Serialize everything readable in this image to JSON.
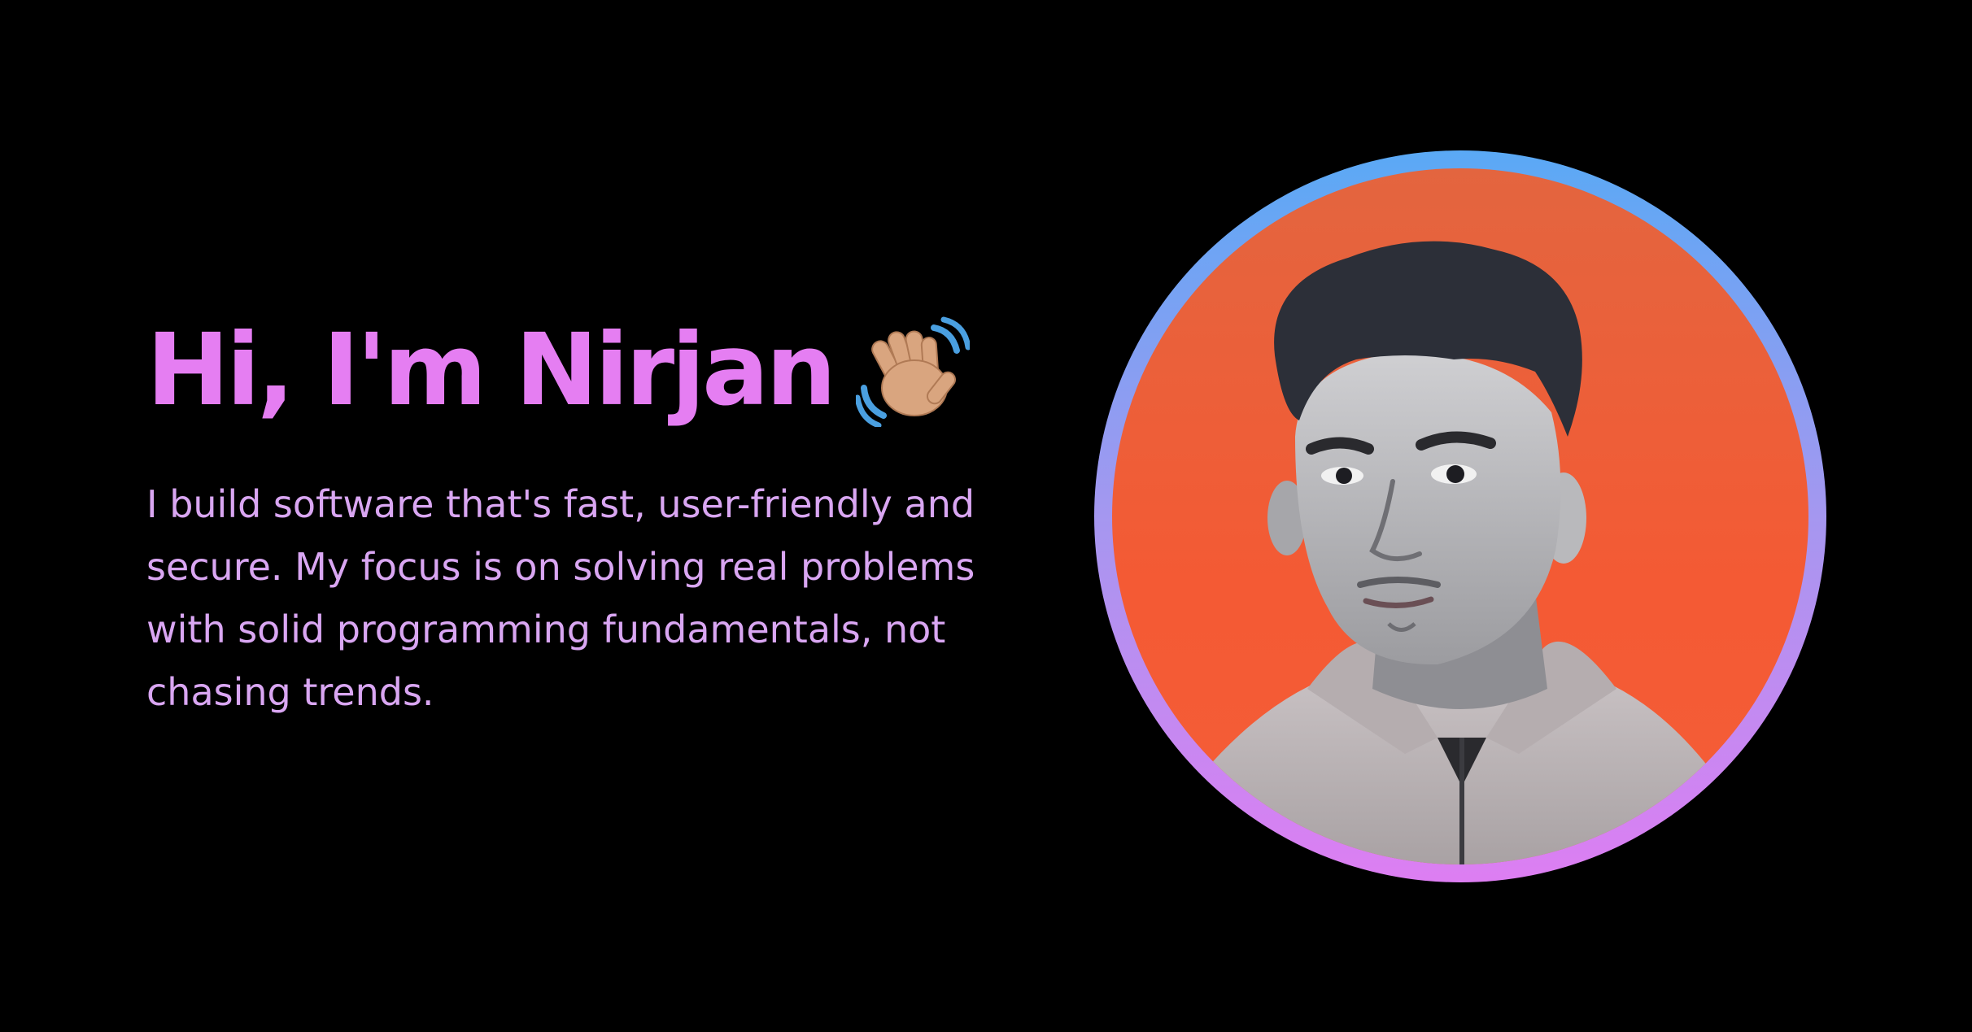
{
  "hero": {
    "greeting": "Hi, I'm Nirjan",
    "wave_icon": "waving-hand-icon",
    "bio_lines": [
      "I build software that's fast, user-friendly and",
      "secure. My focus is on solving real problems",
      "with solid programming fundamentals, not",
      "chasing trends."
    ]
  },
  "portrait": {
    "ring_colors": [
      "#5aa9f5",
      "#a597f0",
      "#dd7ef2"
    ],
    "background_color": "#f45a34"
  },
  "colors": {
    "page_background": "#000000",
    "greeting": "#e57ef2",
    "bio_text": "#d9a6f2"
  }
}
